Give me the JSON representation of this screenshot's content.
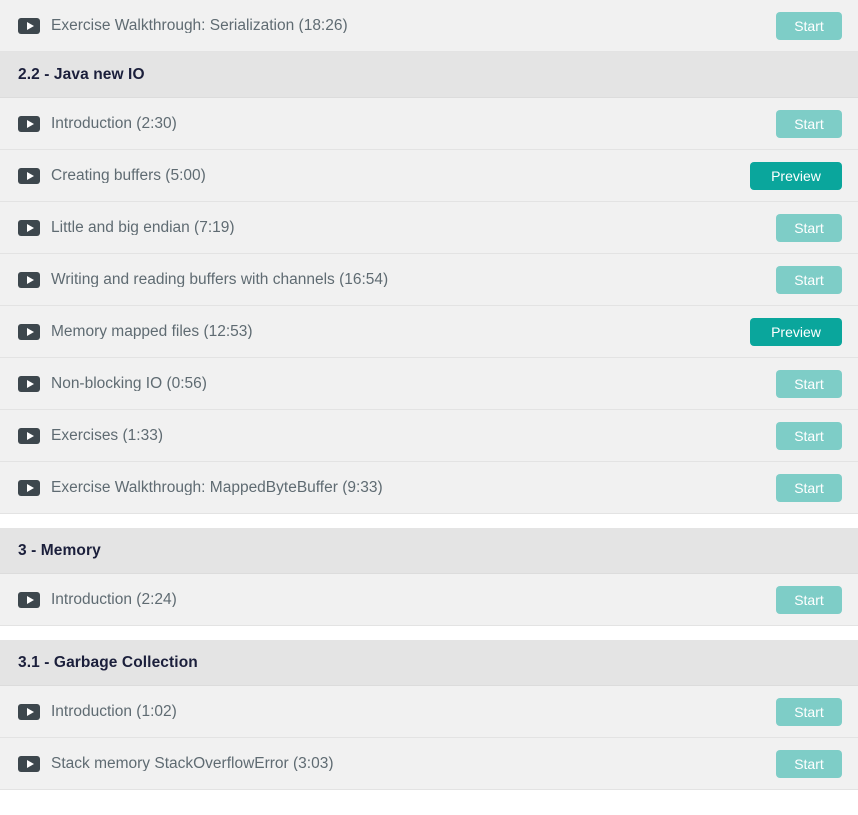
{
  "buttons": {
    "start_label": "Start",
    "preview_label": "Preview",
    "start_color": "#7ecdc7",
    "preview_color": "#0aa69c"
  },
  "colors": {
    "row_bg": "#f1f1f1",
    "header_bg": "#e4e4e4",
    "page_bg": "#ffffff",
    "title_text": "#5f6b72",
    "header_text": "#1b1f3b",
    "play_icon": "#3d474d"
  },
  "icons": {
    "play": "play-badge-icon"
  },
  "top_partial_lecture": {
    "title": "Exercise Walkthrough: Serialization (18:26)",
    "action": "Start"
  },
  "sections": [
    {
      "header": "2.2 - Java new IO",
      "lectures": [
        {
          "title": "Introduction (2:30)",
          "action": "Start"
        },
        {
          "title": "Creating buffers (5:00)",
          "action": "Preview"
        },
        {
          "title": "Little and big endian (7:19)",
          "action": "Start"
        },
        {
          "title": "Writing and reading buffers with channels (16:54)",
          "action": "Start"
        },
        {
          "title": "Memory mapped files (12:53)",
          "action": "Preview"
        },
        {
          "title": "Non-blocking IO (0:56)",
          "action": "Start"
        },
        {
          "title": "Exercises (1:33)",
          "action": "Start"
        },
        {
          "title": "Exercise Walkthrough: MappedByteBuffer (9:33)",
          "action": "Start"
        }
      ]
    },
    {
      "header": "3 - Memory",
      "lectures": [
        {
          "title": "Introduction (2:24)",
          "action": "Start"
        }
      ]
    },
    {
      "header": "3.1 - Garbage Collection",
      "lectures": [
        {
          "title": "Introduction (1:02)",
          "action": "Start"
        },
        {
          "title": "Stack memory StackOverflowError (3:03)",
          "action": "Start"
        }
      ]
    }
  ]
}
